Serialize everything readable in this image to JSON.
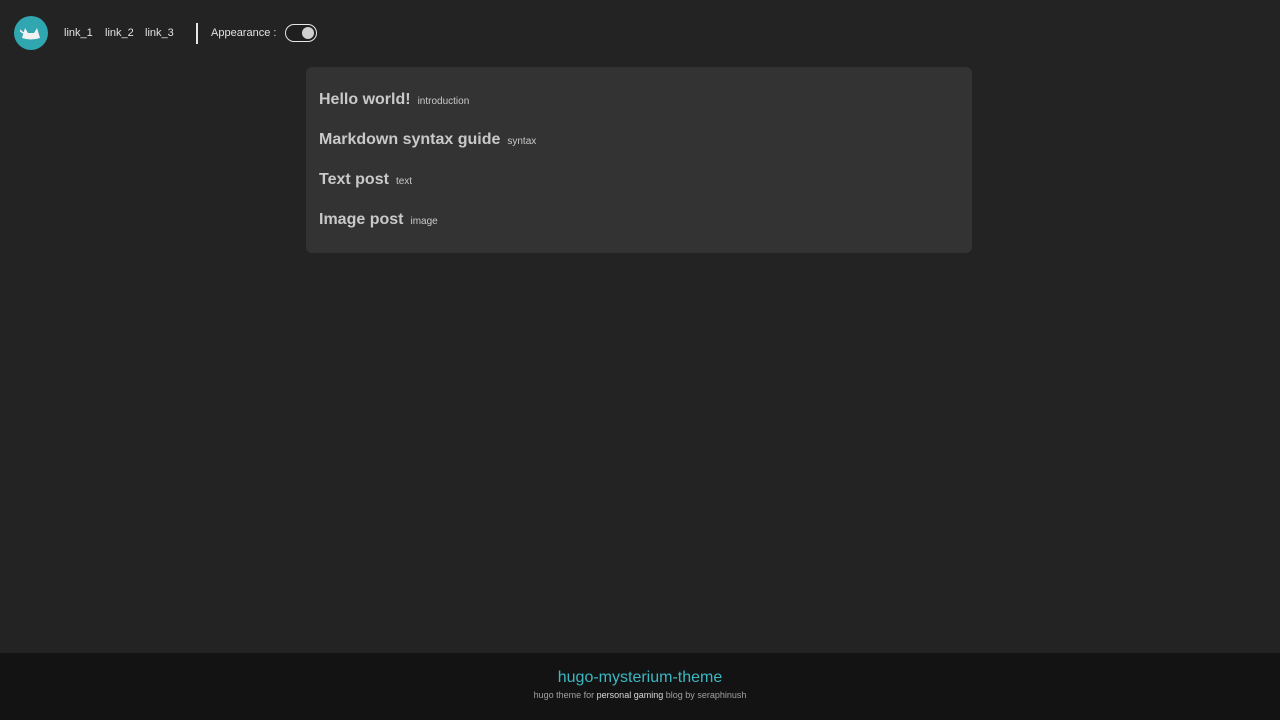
{
  "header": {
    "logo_icon": "cat-logo-icon",
    "links": [
      "link_1",
      "link_2",
      "link_3"
    ],
    "appearance_label": "Appearance :",
    "toggle_state": "on"
  },
  "posts": [
    {
      "title": "Hello world!",
      "tag": "introduction"
    },
    {
      "title": "Markdown syntax guide",
      "tag": "syntax"
    },
    {
      "title": "Text post",
      "tag": "text"
    },
    {
      "title": "Image post",
      "tag": "image"
    }
  ],
  "footer": {
    "title": "hugo-mysterium-theme",
    "sub_prefix": "hugo theme for",
    "sub_personal": "personal",
    "sub_gaming": "gaming",
    "sub_blog": "blog",
    "sub_by": "by",
    "sub_author": "seraphinush"
  },
  "colors": {
    "background": "#232323",
    "card": "#333333",
    "accent": "#3cb8c2",
    "footer_bg": "#131313"
  }
}
